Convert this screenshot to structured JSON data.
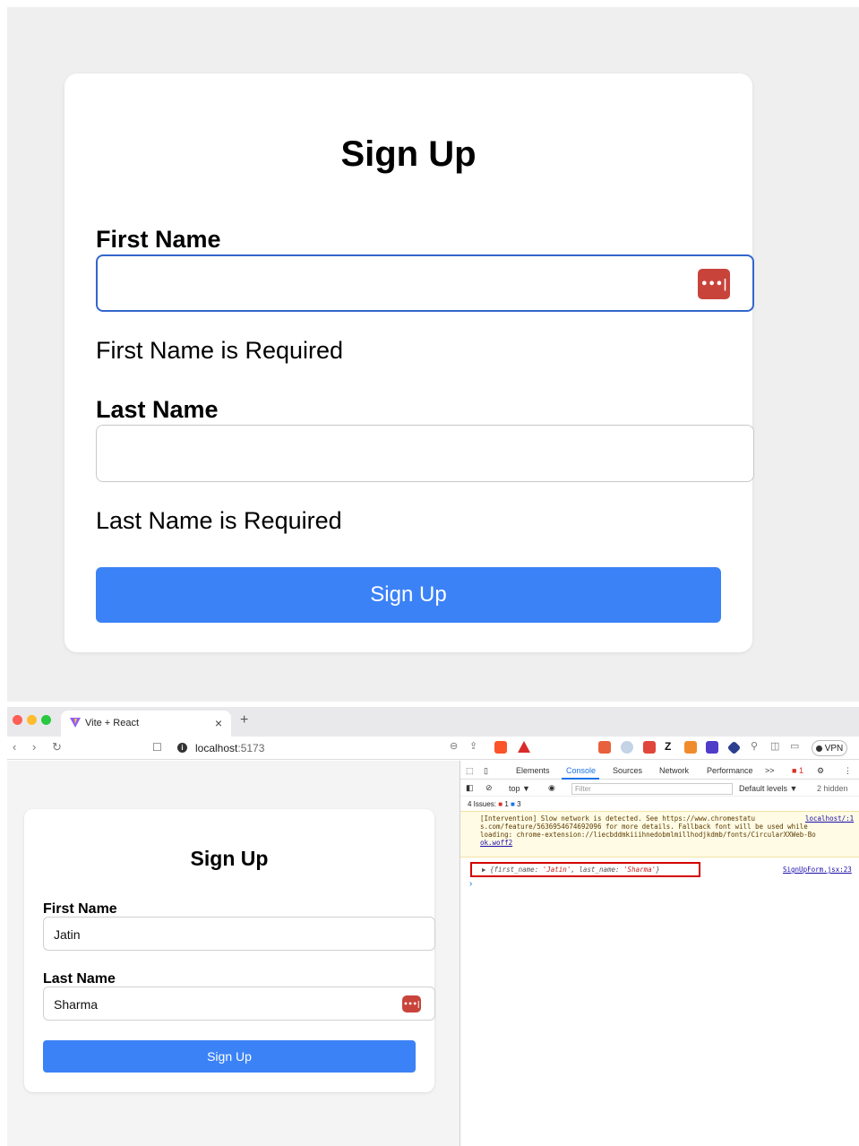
{
  "top_form": {
    "title": "Sign Up",
    "first_name_label": "First Name",
    "first_name_value": "",
    "first_name_error": "First Name is Required",
    "last_name_label": "Last Name",
    "last_name_value": "",
    "last_name_error": "Last Name is Required",
    "submit_label": "Sign Up",
    "password_manager_glyph": "•••|"
  },
  "browser": {
    "tab_title": "Vite + React",
    "tab_close": "×",
    "new_tab": "+",
    "url_host": "localhost",
    "url_port": ":5173",
    "vpn_label": "VPN",
    "page": {
      "title": "Sign Up",
      "first_name_label": "First Name",
      "first_name_value": "Jatin",
      "last_name_label": "Last Name",
      "last_name_value": "Sharma",
      "submit_label": "Sign Up",
      "password_manager_glyph": "•••|"
    },
    "devtools": {
      "tabs": [
        "Elements",
        "Console",
        "Sources",
        "Network",
        "Performance",
        ">>"
      ],
      "active_tab": "Console",
      "issues_badge": "1",
      "context": "top ▼",
      "filter_placeholder": "Filter",
      "levels": "Default levels ▼",
      "hidden_count": "2 hidden",
      "issues_text": "4 Issues:",
      "issues_error_count": "1",
      "issues_info_count": "3",
      "warning_lines": [
        "[Intervention] Slow network is detected. See https://www.chromestatu",
        "s.com/feature/5636954674692096 for more details. Fallback font will be used while",
        "loading: chrome-extension://liecbddmkiiihnedobmlmillhodjkdmb/fonts/CircularXXWeb-Bo",
        "ok.woff2"
      ],
      "warning_source": "localhost/:1",
      "log_prefix": "▶ {first_name: ",
      "log_first": "'Jatin'",
      "log_mid": ", last_name: ",
      "log_last": "'Sharma'",
      "log_suffix": "}",
      "log_source": "SignUpForm.jsx:23",
      "prompt": "›"
    }
  },
  "colors": {
    "primary": "#3b82f6",
    "focus_border": "#3366cc",
    "password_badge": "#c8443b",
    "highlight_box": "#d40000"
  }
}
